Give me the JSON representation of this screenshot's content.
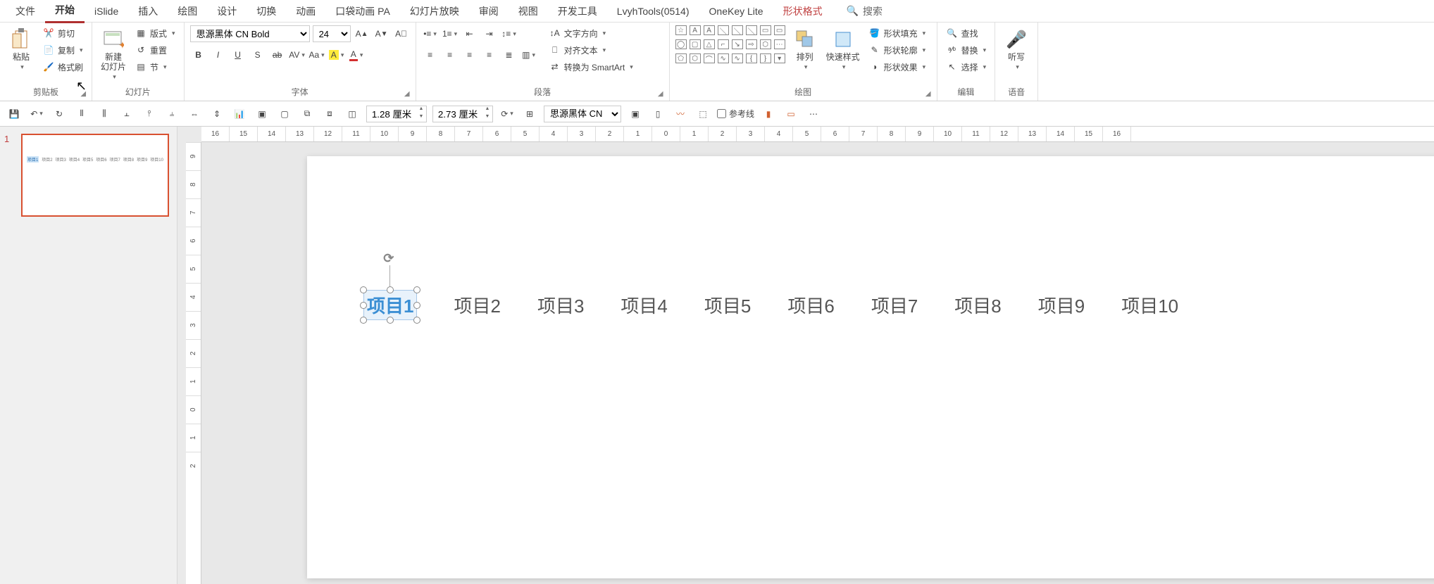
{
  "tabs": {
    "file": "文件",
    "home": "开始",
    "islide": "iSlide",
    "insert": "插入",
    "draw": "绘图",
    "design": "设计",
    "transition": "切换",
    "animation": "动画",
    "pocket": "口袋动画 PA",
    "slideshow": "幻灯片放映",
    "review": "审阅",
    "view": "视图",
    "developer": "开发工具",
    "lvyh": "LvyhTools(0514)",
    "onekey": "OneKey Lite",
    "shapefmt": "形状格式",
    "search": "搜索"
  },
  "ribbon": {
    "clipboard": {
      "paste": "粘贴",
      "cut": "剪切",
      "copy": "复制",
      "format_painter": "格式刷",
      "label": "剪贴板"
    },
    "slides": {
      "new": "新建\n幻灯片",
      "layout": "版式",
      "reset": "重置",
      "section": "节",
      "label": "幻灯片"
    },
    "font": {
      "name": "思源黑体 CN Bold",
      "size": "24",
      "label": "字体"
    },
    "paragraph": {
      "text_direction": "文字方向",
      "align_text": "对齐文本",
      "smartart": "转换为 SmartArt",
      "label": "段落"
    },
    "drawing": {
      "arrange": "排列",
      "quick_styles": "快速样式",
      "fill": "形状填充",
      "outline": "形状轮廓",
      "effects": "形状效果",
      "label": "绘图"
    },
    "editing": {
      "find": "查找",
      "replace": "替换",
      "select": "选择",
      "label": "编辑"
    },
    "voice": {
      "dictate": "听写",
      "label": "语音"
    }
  },
  "qat": {
    "width": "1.28 厘米",
    "height": "2.73 厘米",
    "font2": "思源黑体 CN",
    "guides": "参考线"
  },
  "ruler_h": [
    "16",
    "15",
    "14",
    "13",
    "12",
    "11",
    "10",
    "9",
    "8",
    "7",
    "6",
    "5",
    "4",
    "3",
    "2",
    "1",
    "0",
    "1",
    "2",
    "3",
    "4",
    "5",
    "6",
    "7",
    "8",
    "9",
    "10",
    "11",
    "12",
    "13",
    "14",
    "15",
    "16"
  ],
  "ruler_v": [
    "9",
    "8",
    "7",
    "6",
    "5",
    "4",
    "3",
    "2",
    "1",
    "0",
    "1",
    "2"
  ],
  "slide_number": "1",
  "canvas": {
    "items": [
      "项目1",
      "项目2",
      "项目3",
      "项目4",
      "项目5",
      "项目6",
      "项目7",
      "项目8",
      "项目9",
      "项目10"
    ]
  }
}
